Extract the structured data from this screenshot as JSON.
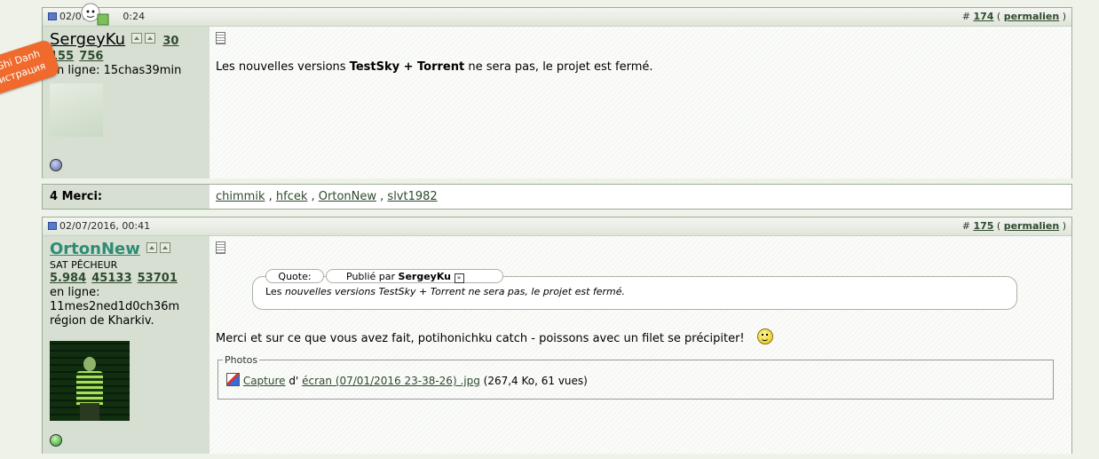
{
  "post1": {
    "date": "02/07/",
    "date_tail": "0:24",
    "number_prefix": "#",
    "number": "174",
    "permalink_label": "permalien",
    "username": "SergeyKu",
    "reputation": "30",
    "stats": [
      "155",
      "756"
    ],
    "online_label": "en ligne: 15chas39min",
    "message_pre": "Les nouvelles versions ",
    "message_bold": "TestSky + Torrent",
    "message_post": " ne sera pas, le projet est fermé."
  },
  "thanks": {
    "label": "4 Merci:",
    "users": [
      "chimmik",
      "hfcek",
      "OrtonNew",
      "slvt1982"
    ]
  },
  "post2": {
    "date": "02/07/2016, 00:41",
    "number_prefix": "#",
    "number": "175",
    "permalink_label": "permalien",
    "username": "OrtonNew",
    "user_title": "SAT PÊCHEUR",
    "stats": [
      "5.984",
      "45133",
      "53701"
    ],
    "online_label": "en ligne:",
    "online_time": "11mes2ned1d0ch36m",
    "region": "région de Kharkiv.",
    "quote_label": "Quote:",
    "quote_posted_by": "Publié par",
    "quote_author": "SergeyKu",
    "quote_text_pre": "Les ",
    "quote_text_italic": "nouvelles versions",
    "quote_text_post": " TestSky + Torrent ne sera pas, le projet est fermé.",
    "message": "Merci et sur ce que vous avez fait, potihonichku catch - poissons avec un filet se précipiter!",
    "attachments_legend": "Photos",
    "attachment_link_1": "Capture",
    "attachment_mid": "d'",
    "attachment_link_2": "écran (07/01/2016 23-38-26) .jpg",
    "attachment_info": "(267,4 Ko, 61 vues)"
  },
  "overlay": {
    "ribbon_line1": "Ghi Danh",
    "ribbon_line2": "истрация"
  },
  "colors": {
    "page_bg": "#eef2e9",
    "userinfo_bg": "#d6dfd2",
    "username_green": "#2e8b74",
    "ribbon_orange": "#ef6a2c"
  }
}
